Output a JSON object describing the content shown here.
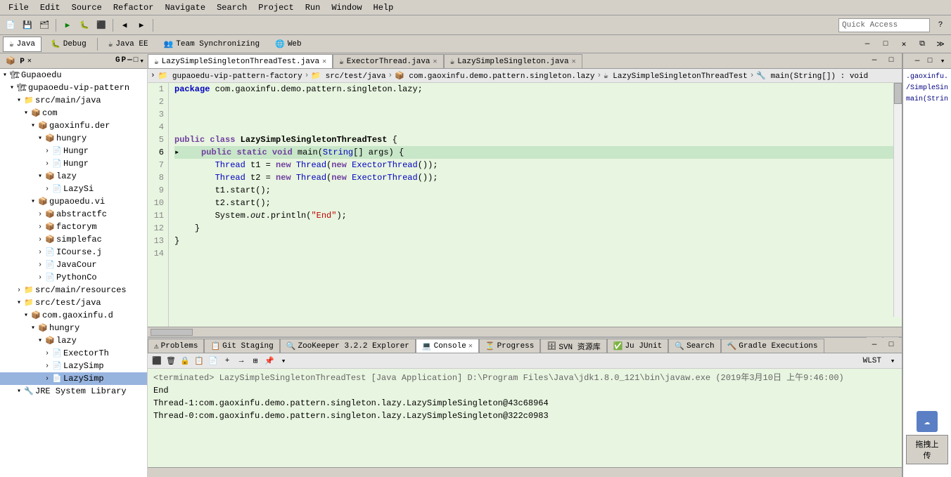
{
  "menu": {
    "items": [
      "File",
      "Edit",
      "Source",
      "Refactor",
      "Navigate",
      "Search",
      "Project",
      "Run",
      "Window",
      "Help"
    ]
  },
  "toolbar": {
    "quick_access_placeholder": "Quick Access"
  },
  "perspectives": {
    "items": [
      {
        "label": "Java",
        "icon": "☕",
        "active": true
      },
      {
        "label": "Debug",
        "icon": "🐛",
        "active": false
      },
      {
        "label": "Java EE",
        "icon": "☕",
        "active": false
      },
      {
        "label": "Team Synchronizing",
        "icon": "👥",
        "active": false
      },
      {
        "label": "Web",
        "icon": "🌐",
        "active": false
      }
    ]
  },
  "sidebar": {
    "tabs": [
      {
        "label": "P",
        "id": "package"
      },
      {
        "label": "G",
        "id": "git"
      },
      {
        "label": "P",
        "id": "project"
      }
    ],
    "tree": [
      {
        "indent": 0,
        "arrow": "▾",
        "icon": "🏗",
        "label": "Gupaoedu",
        "expanded": true
      },
      {
        "indent": 1,
        "arrow": "▾",
        "icon": "🏗",
        "label": "gupaoedu-vip-pattern",
        "expanded": true
      },
      {
        "indent": 2,
        "arrow": "▾",
        "icon": "📁",
        "label": "src/main/java",
        "expanded": true
      },
      {
        "indent": 3,
        "arrow": "▾",
        "icon": "📦",
        "label": "com",
        "expanded": true
      },
      {
        "indent": 4,
        "arrow": "▾",
        "icon": "📦",
        "label": "gaoxinfu.der",
        "expanded": true
      },
      {
        "indent": 5,
        "arrow": "▾",
        "icon": "📦",
        "label": "hungry",
        "expanded": true
      },
      {
        "indent": 6,
        "arrow": "›",
        "icon": "📄",
        "label": "Hungr",
        "expanded": false
      },
      {
        "indent": 6,
        "arrow": "›",
        "icon": "📄",
        "label": "Hungr",
        "expanded": false
      },
      {
        "indent": 5,
        "arrow": "▾",
        "icon": "📦",
        "label": "lazy",
        "expanded": true
      },
      {
        "indent": 6,
        "arrow": "›",
        "icon": "📄",
        "label": "LazySi",
        "expanded": false
      },
      {
        "indent": 4,
        "arrow": "▾",
        "icon": "📦",
        "label": "gupaoedu.vi",
        "expanded": true
      },
      {
        "indent": 5,
        "arrow": "›",
        "icon": "📦",
        "label": "abstractfc",
        "expanded": false
      },
      {
        "indent": 5,
        "arrow": "›",
        "icon": "📦",
        "label": "factorym",
        "expanded": false
      },
      {
        "indent": 5,
        "arrow": "›",
        "icon": "📦",
        "label": "simplefac",
        "expanded": false
      },
      {
        "indent": 5,
        "arrow": "›",
        "icon": "📄",
        "label": "ICourse.j",
        "expanded": false
      },
      {
        "indent": 5,
        "arrow": "›",
        "icon": "📄",
        "label": "JavaCour",
        "expanded": false
      },
      {
        "indent": 5,
        "arrow": "›",
        "icon": "📄",
        "label": "PythonCo",
        "expanded": false
      },
      {
        "indent": 2,
        "arrow": "›",
        "icon": "📁",
        "label": "src/main/resources",
        "expanded": false
      },
      {
        "indent": 2,
        "arrow": "▾",
        "icon": "📁",
        "label": "src/test/java",
        "expanded": true
      },
      {
        "indent": 3,
        "arrow": "▾",
        "icon": "📦",
        "label": "com.gaoxinfu.d",
        "expanded": true
      },
      {
        "indent": 4,
        "arrow": "▾",
        "icon": "📦",
        "label": "hungry",
        "expanded": true
      },
      {
        "indent": 5,
        "arrow": "▾",
        "icon": "📦",
        "label": "lazy",
        "expanded": true
      },
      {
        "indent": 6,
        "arrow": "›",
        "icon": "📄",
        "label": "ExectorTh",
        "expanded": false
      },
      {
        "indent": 6,
        "arrow": "›",
        "icon": "📄",
        "label": "LazySimp",
        "expanded": false
      },
      {
        "indent": 6,
        "arrow": "›",
        "icon": "📄",
        "label": "LazySimp",
        "expanded": false,
        "selected": true
      },
      {
        "indent": 2,
        "arrow": "▾",
        "icon": "🔧",
        "label": "JRE System Library",
        "expanded": true
      }
    ]
  },
  "editor": {
    "tabs": [
      {
        "label": "LazySimpleSingletonThreadTest.java",
        "active": true,
        "modified": false
      },
      {
        "label": "ExectorThread.java",
        "active": false,
        "modified": false
      },
      {
        "label": "LazySimpleSingleton.java",
        "active": false,
        "modified": false
      }
    ],
    "breadcrumb": [
      "gupaoedu-vip-pattern-factory",
      "src/test/java",
      "com.gaoxinfu.demo.pattern.singleton.lazy",
      "LazySimpleSingletonThreadTest",
      "main(String[]) : void"
    ],
    "lines": [
      {
        "num": 1,
        "text": "package com.gaoxinfu.demo.pattern.singleton.lazy;"
      },
      {
        "num": 2,
        "text": ""
      },
      {
        "num": 3,
        "text": ""
      },
      {
        "num": 4,
        "text": ""
      },
      {
        "num": 5,
        "text": ""
      },
      {
        "num": 6,
        "text": "    public static void main(String[] args) {",
        "has_arrow": true
      },
      {
        "num": 7,
        "text": "        Thread t1 = new Thread(new ExectorThread());"
      },
      {
        "num": 8,
        "text": "        Thread t2 = new Thread(new ExectorThread());"
      },
      {
        "num": 9,
        "text": "        t1.start();"
      },
      {
        "num": 10,
        "text": "        t2.start();"
      },
      {
        "num": 11,
        "text": "        System.out.println(\"End\");"
      },
      {
        "num": 12,
        "text": "    }"
      },
      {
        "num": 13,
        "text": "}"
      },
      {
        "num": 14,
        "text": ""
      }
    ],
    "class_declaration": "public class LazySimpleSingletonThreadTest {"
  },
  "right_panel": {
    "text_lines": [
      ".gaoxinfu.demo.p",
      "/SimpleSingletonT",
      "main(String[]) : vo"
    ]
  },
  "console": {
    "tabs": [
      {
        "label": "Problems",
        "icon": "⚠",
        "active": false
      },
      {
        "label": "Git Staging",
        "icon": "📋",
        "active": false
      },
      {
        "label": "ZooKeeper 3.2.2 Explorer",
        "icon": "🔍",
        "active": false
      },
      {
        "label": "Console",
        "icon": "💻",
        "active": true
      },
      {
        "label": "Progress",
        "icon": "⏳",
        "active": false
      },
      {
        "label": "SVN 资源库",
        "icon": "🗄",
        "active": false
      },
      {
        "label": "Ju JUnit",
        "icon": "✅",
        "active": false
      },
      {
        "label": "Search",
        "icon": "🔍",
        "active": false
      },
      {
        "label": "Gradle Executions",
        "icon": "🔨",
        "active": false
      }
    ],
    "terminated_line": "<terminated> LazySimpleSingletonThreadTest [Java Application] D:\\Program Files\\Java\\jdk1.8.0_121\\bin\\javaw.exe (2019年3月10日 上午9:46:00)",
    "output_lines": [
      "End",
      "Thread-1:com.gaoxinfu.demo.pattern.singleton.lazy.LazySimpleSingleton@43c68964",
      "Thread-0:com.gaoxinfu.demo.pattern.singleton.lazy.LazySimpleSingleton@322c0983"
    ],
    "wlst_label": "WLST"
  },
  "upload_btn_label": "拖拽上传"
}
